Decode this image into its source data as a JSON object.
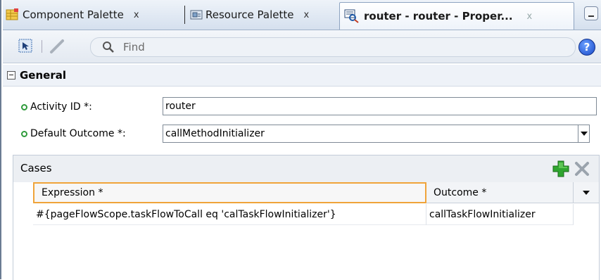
{
  "tabs": [
    {
      "label": "Component Palette",
      "close": "x",
      "icon": "component-palette-icon"
    },
    {
      "label": "Resource Palette",
      "close": "x",
      "icon": "resource-palette-icon"
    },
    {
      "label": "router - router - Proper...",
      "close": "x",
      "icon": "property-inspector-icon",
      "active": true
    }
  ],
  "toolbar": {
    "search_placeholder": "Find",
    "help_label": "?"
  },
  "general": {
    "title": "General",
    "fields": [
      {
        "label": "Activity ID *:",
        "value": "router",
        "required": true
      },
      {
        "label": "Default Outcome *:",
        "value": "callMethodInitializer",
        "required": true,
        "type": "combo"
      }
    ]
  },
  "cases": {
    "title": "Cases",
    "columns": [
      "Expression *",
      "Outcome *"
    ],
    "rows": [
      {
        "expression": "#{pageFlowScope.taskFlowToCall eq 'calTaskFlowInitializer'}",
        "outcome": "callTaskFlowInitializer"
      }
    ]
  },
  "colors": {
    "active_column_border": "#f0a43a",
    "required_dot": "#2f9b3b",
    "add_icon": "#2fa52f",
    "help_icon": "#1848c8"
  }
}
